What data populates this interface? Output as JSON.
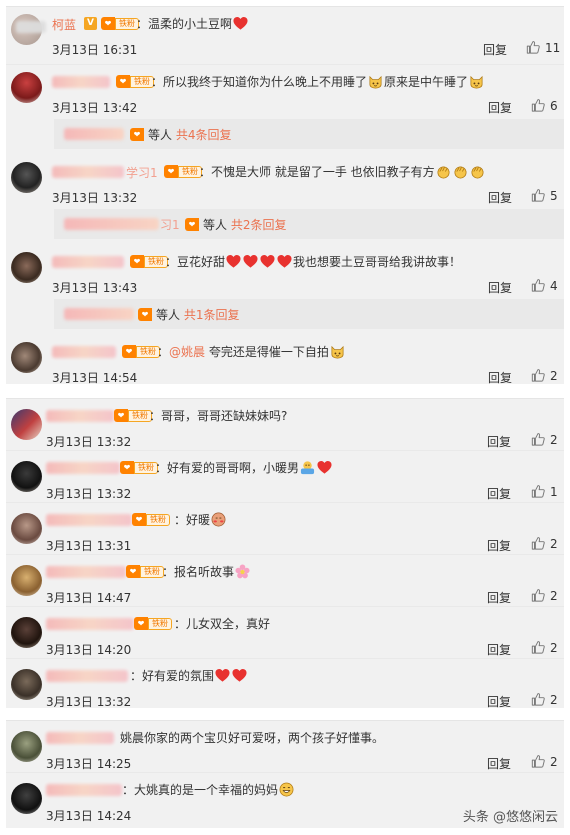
{
  "section1": {
    "comments": [
      {
        "name": "柯蓝",
        "fan_label": "铁粉",
        "text": "：温柔的小土豆啊",
        "time": "3月13日 16:31",
        "reply": "回复",
        "likes": "11"
      },
      {
        "fan_label": "铁粉",
        "text_a": "：所以我终于知道你为什么晚上不用睡了",
        "text_b": "原来是中午睡了",
        "time": "3月13日 13:42",
        "reply": "回复",
        "likes": "6",
        "subreply": {
          "prefix": "等人",
          "count": "共4条回复"
        }
      },
      {
        "name_tail": "学习1",
        "fan_label": "铁粉",
        "text": "：不愧是大师 就是留了一手 也依旧教子有方",
        "time": "3月13日 13:32",
        "reply": "回复",
        "likes": "5",
        "subreply": {
          "name_tail": "习1",
          "prefix": "等人",
          "count": "共2条回复"
        }
      },
      {
        "fan_label": "铁粉",
        "text_a": "：豆花好甜",
        "text_b": "我也想要土豆哥哥给我讲故事！",
        "time": "3月13日 13:43",
        "reply": "回复",
        "likes": "4",
        "subreply": {
          "prefix": "等人",
          "count": "共1条回复"
        }
      },
      {
        "fan_label": "铁粉",
        "mention": "@姚晨",
        "text": " 夸完还是得催一下自拍",
        "time": "3月13日 14:54",
        "reply": "回复",
        "likes": "2"
      }
    ]
  },
  "section2": {
    "comments": [
      {
        "fan_label": "铁粉",
        "text": "：哥哥，哥哥还缺妹妹吗?",
        "time": "3月13日 13:32",
        "reply": "回复",
        "likes": "2"
      },
      {
        "fan_label": "铁粉",
        "text": "：好有爱的哥哥啊，小暖男",
        "time": "3月13日 13:32",
        "reply": "回复",
        "likes": "1"
      },
      {
        "fan_label": "铁粉",
        "text": "：好暖",
        "time": "3月13日 13:31",
        "reply": "回复",
        "likes": "2"
      },
      {
        "fan_label": "铁粉",
        "text": "：报名听故事",
        "time": "3月13日 14:47",
        "reply": "回复",
        "likes": "2"
      },
      {
        "fan_label": "铁粉",
        "text": "：儿女双全，真好",
        "time": "3月13日 14:20",
        "reply": "回复",
        "likes": "2"
      },
      {
        "text": "：好有爱的氛围",
        "time": "3月13日 13:32",
        "reply": "回复",
        "likes": "2"
      }
    ]
  },
  "section3": {
    "comments": [
      {
        "text": "姚晨你家的两个宝贝好可爱呀，两个孩子好懂事。",
        "time": "3月13日 14:25",
        "reply": "回复",
        "likes": "2"
      },
      {
        "text": "：大姚真的是一个幸福的妈妈",
        "time": "3月13日 14:24"
      }
    ]
  },
  "watermark": "头条 @悠悠闲云",
  "colors": {
    "accent": "#eb7350",
    "badge": "#f5a623",
    "heart": "#e8322f",
    "section_bg": "#f1f1f1"
  },
  "icons": [
    "heart-emoji",
    "cat-emoji",
    "clap-emoji",
    "hug-emoji",
    "flower-emoji",
    "shy-emoji",
    "smile-emoji",
    "thumbs-up-icon"
  ]
}
